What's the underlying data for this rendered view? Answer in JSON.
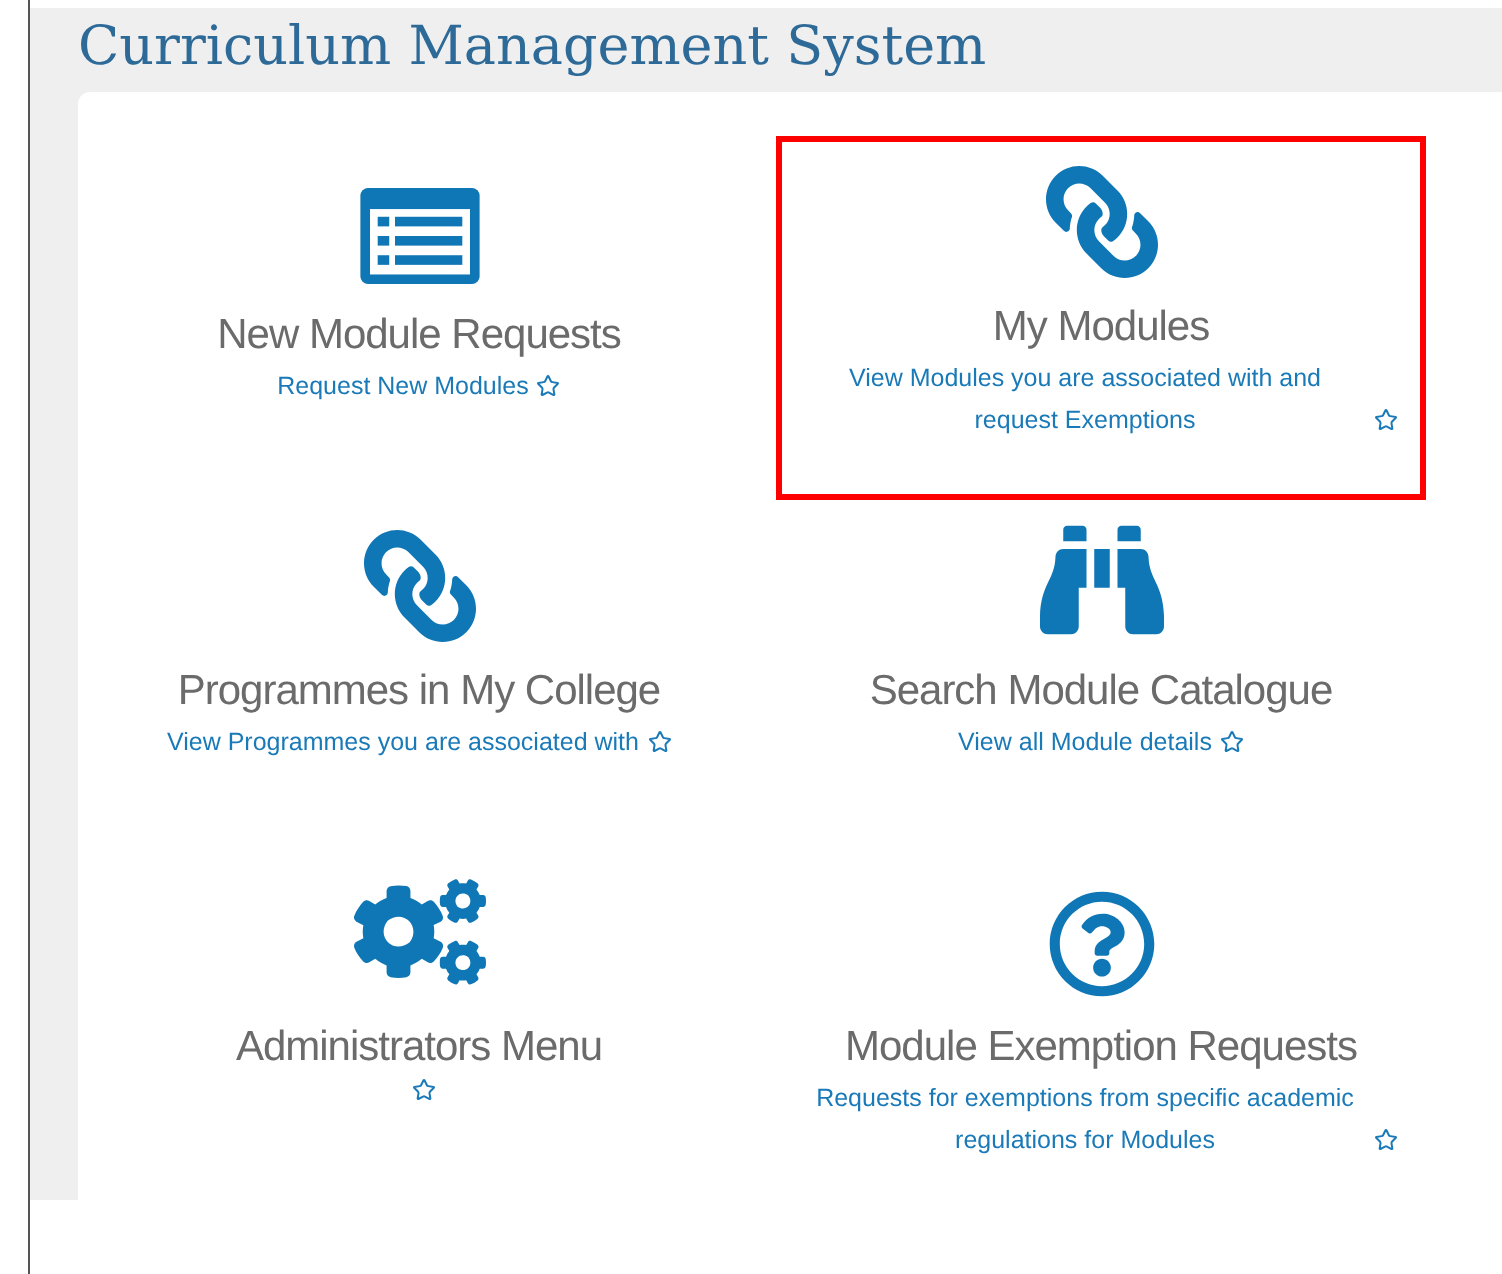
{
  "page_title": "Curriculum Management System",
  "tiles": [
    {
      "title": "New Module Requests",
      "description": "Request New Modules",
      "highlighted": false
    },
    {
      "title": "My Modules",
      "description": "View Modules you are associated with and request Exemptions",
      "highlighted": true
    },
    {
      "title": "Programmes in My College",
      "description": "View Programmes you are associated with",
      "highlighted": false
    },
    {
      "title": "Search Module Catalogue",
      "description": "View all Module details",
      "highlighted": false
    },
    {
      "title": "Administrators Menu",
      "highlighted": false
    },
    {
      "title": "Module Exemption Requests",
      "description": "Requests for exemptions from specific academic regulations for Modules",
      "highlighted": false
    }
  ]
}
